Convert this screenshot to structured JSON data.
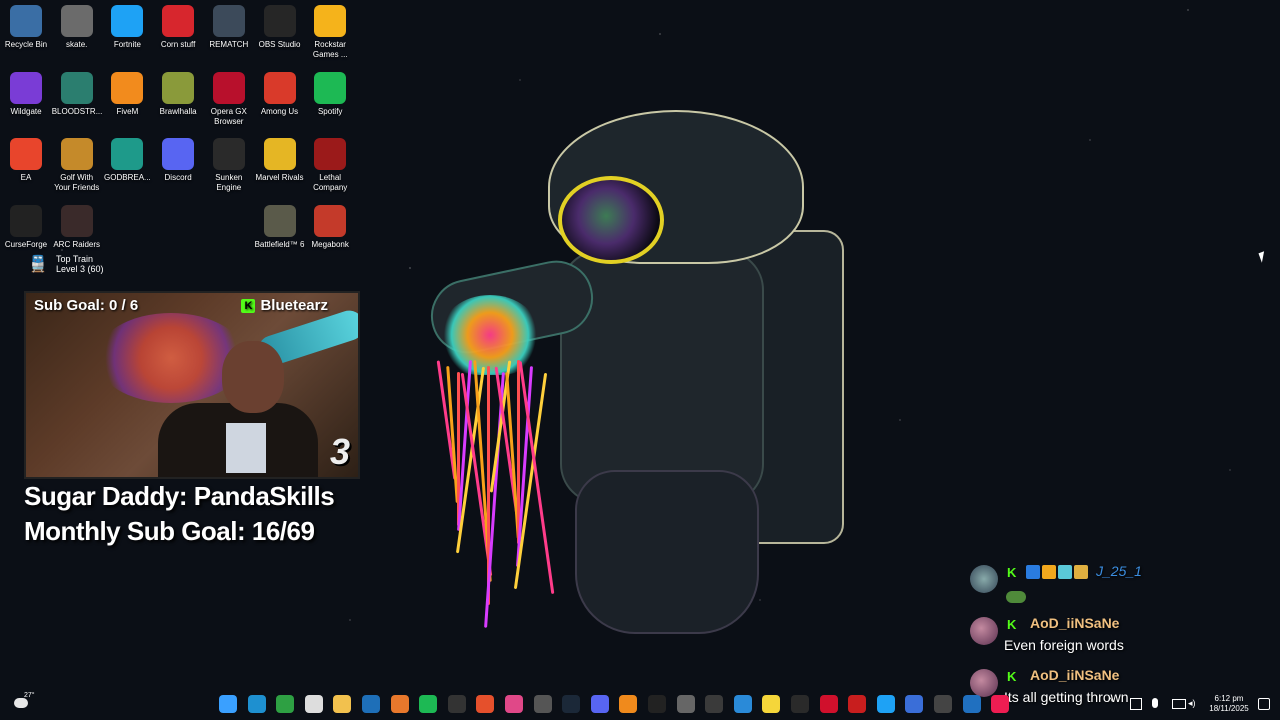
{
  "desktop_icons": [
    {
      "label": "Recycle Bin",
      "icon": "recycle-bin-icon",
      "color": "#3a6ea5"
    },
    {
      "label": "skate.",
      "icon": "skate-icon",
      "color": "#6b6b6b"
    },
    {
      "label": "Fortnite",
      "icon": "fortnite-icon",
      "color": "#1ea2f5"
    },
    {
      "label": "Corn stuff",
      "icon": "power-icon",
      "color": "#d7262d"
    },
    {
      "label": "REMATCH",
      "icon": "rematch-icon",
      "color": "#3c4a5a"
    },
    {
      "label": "OBS Studio",
      "icon": "obs-icon",
      "color": "#262626"
    },
    {
      "label": "Rockstar Games ...",
      "icon": "rockstar-icon",
      "color": "#f5b31b"
    },
    {
      "label": "Wildgate",
      "icon": "wildgate-icon",
      "color": "#7a3cd6"
    },
    {
      "label": "BLOODSTR...",
      "icon": "bloodstrike-icon",
      "color": "#2b7e6f"
    },
    {
      "label": "FiveM",
      "icon": "fivem-icon",
      "color": "#f28b1d"
    },
    {
      "label": "Brawlhalla",
      "icon": "brawlhalla-icon",
      "color": "#8a9a3a"
    },
    {
      "label": "Opera GX Browser",
      "icon": "opera-gx-icon",
      "color": "#b8102c"
    },
    {
      "label": "Among Us",
      "icon": "among-us-icon",
      "color": "#d93a2a"
    },
    {
      "label": "Spotify",
      "icon": "spotify-icon",
      "color": "#1db954"
    },
    {
      "label": "EA",
      "icon": "ea-icon",
      "color": "#e8452c"
    },
    {
      "label": "Golf With Your Friends",
      "icon": "golf-icon",
      "color": "#c58a2a"
    },
    {
      "label": "GODBREA...",
      "icon": "godbreaker-icon",
      "color": "#1e9a8a"
    },
    {
      "label": "Discord",
      "icon": "discord-icon",
      "color": "#5865f2"
    },
    {
      "label": "Sunken Engine",
      "icon": "eye-icon",
      "color": "#2a2a2a"
    },
    {
      "label": "Marvel Rivals",
      "icon": "marvel-rivals-icon",
      "color": "#e5b624"
    },
    {
      "label": "Lethal Company",
      "icon": "lethal-company-icon",
      "color": "#9b1a1a"
    },
    {
      "label": "CurseForge",
      "icon": "curseforge-icon",
      "color": "#222222"
    },
    {
      "label": "ARC Raiders",
      "icon": "arc-raiders-icon",
      "color": "#3a2a2a"
    },
    {
      "label": "Battlefield™ 6",
      "icon": "battlefield-icon",
      "color": "#5a5a4a"
    },
    {
      "label": "Megabonk",
      "icon": "megabonk-icon",
      "color": "#c43a2a"
    }
  ],
  "top_train": {
    "title": "Top Train",
    "level": "Level 3  (60)"
  },
  "webcam": {
    "sub_goal": "Sub Goal:  0 / 6",
    "streamer": "Bluetearz",
    "k_badge": "K",
    "logo": "3"
  },
  "overlay": {
    "sugar_daddy": "Sugar Daddy: PandaSkills",
    "monthly_goal": "Monthly Sub Goal: 16/69"
  },
  "chat": [
    {
      "name": "J_25_1",
      "message": "",
      "name_color": "#3b8de0",
      "has_badges": true
    },
    {
      "name": "AoD_iiNSaNe",
      "message": "Even foreign words",
      "name_color": "#f0c080"
    },
    {
      "name": "AoD_iiNSaNe",
      "message": "Its all getting thrown",
      "name_color": "#f0c080"
    }
  ],
  "chat_k": "K",
  "taskbar": {
    "weather_temp": "27°",
    "time": "6:12 pm",
    "date": "18/11/2025"
  },
  "colors": {
    "kick_green": "#53fc18",
    "background": "#0b0f16"
  }
}
